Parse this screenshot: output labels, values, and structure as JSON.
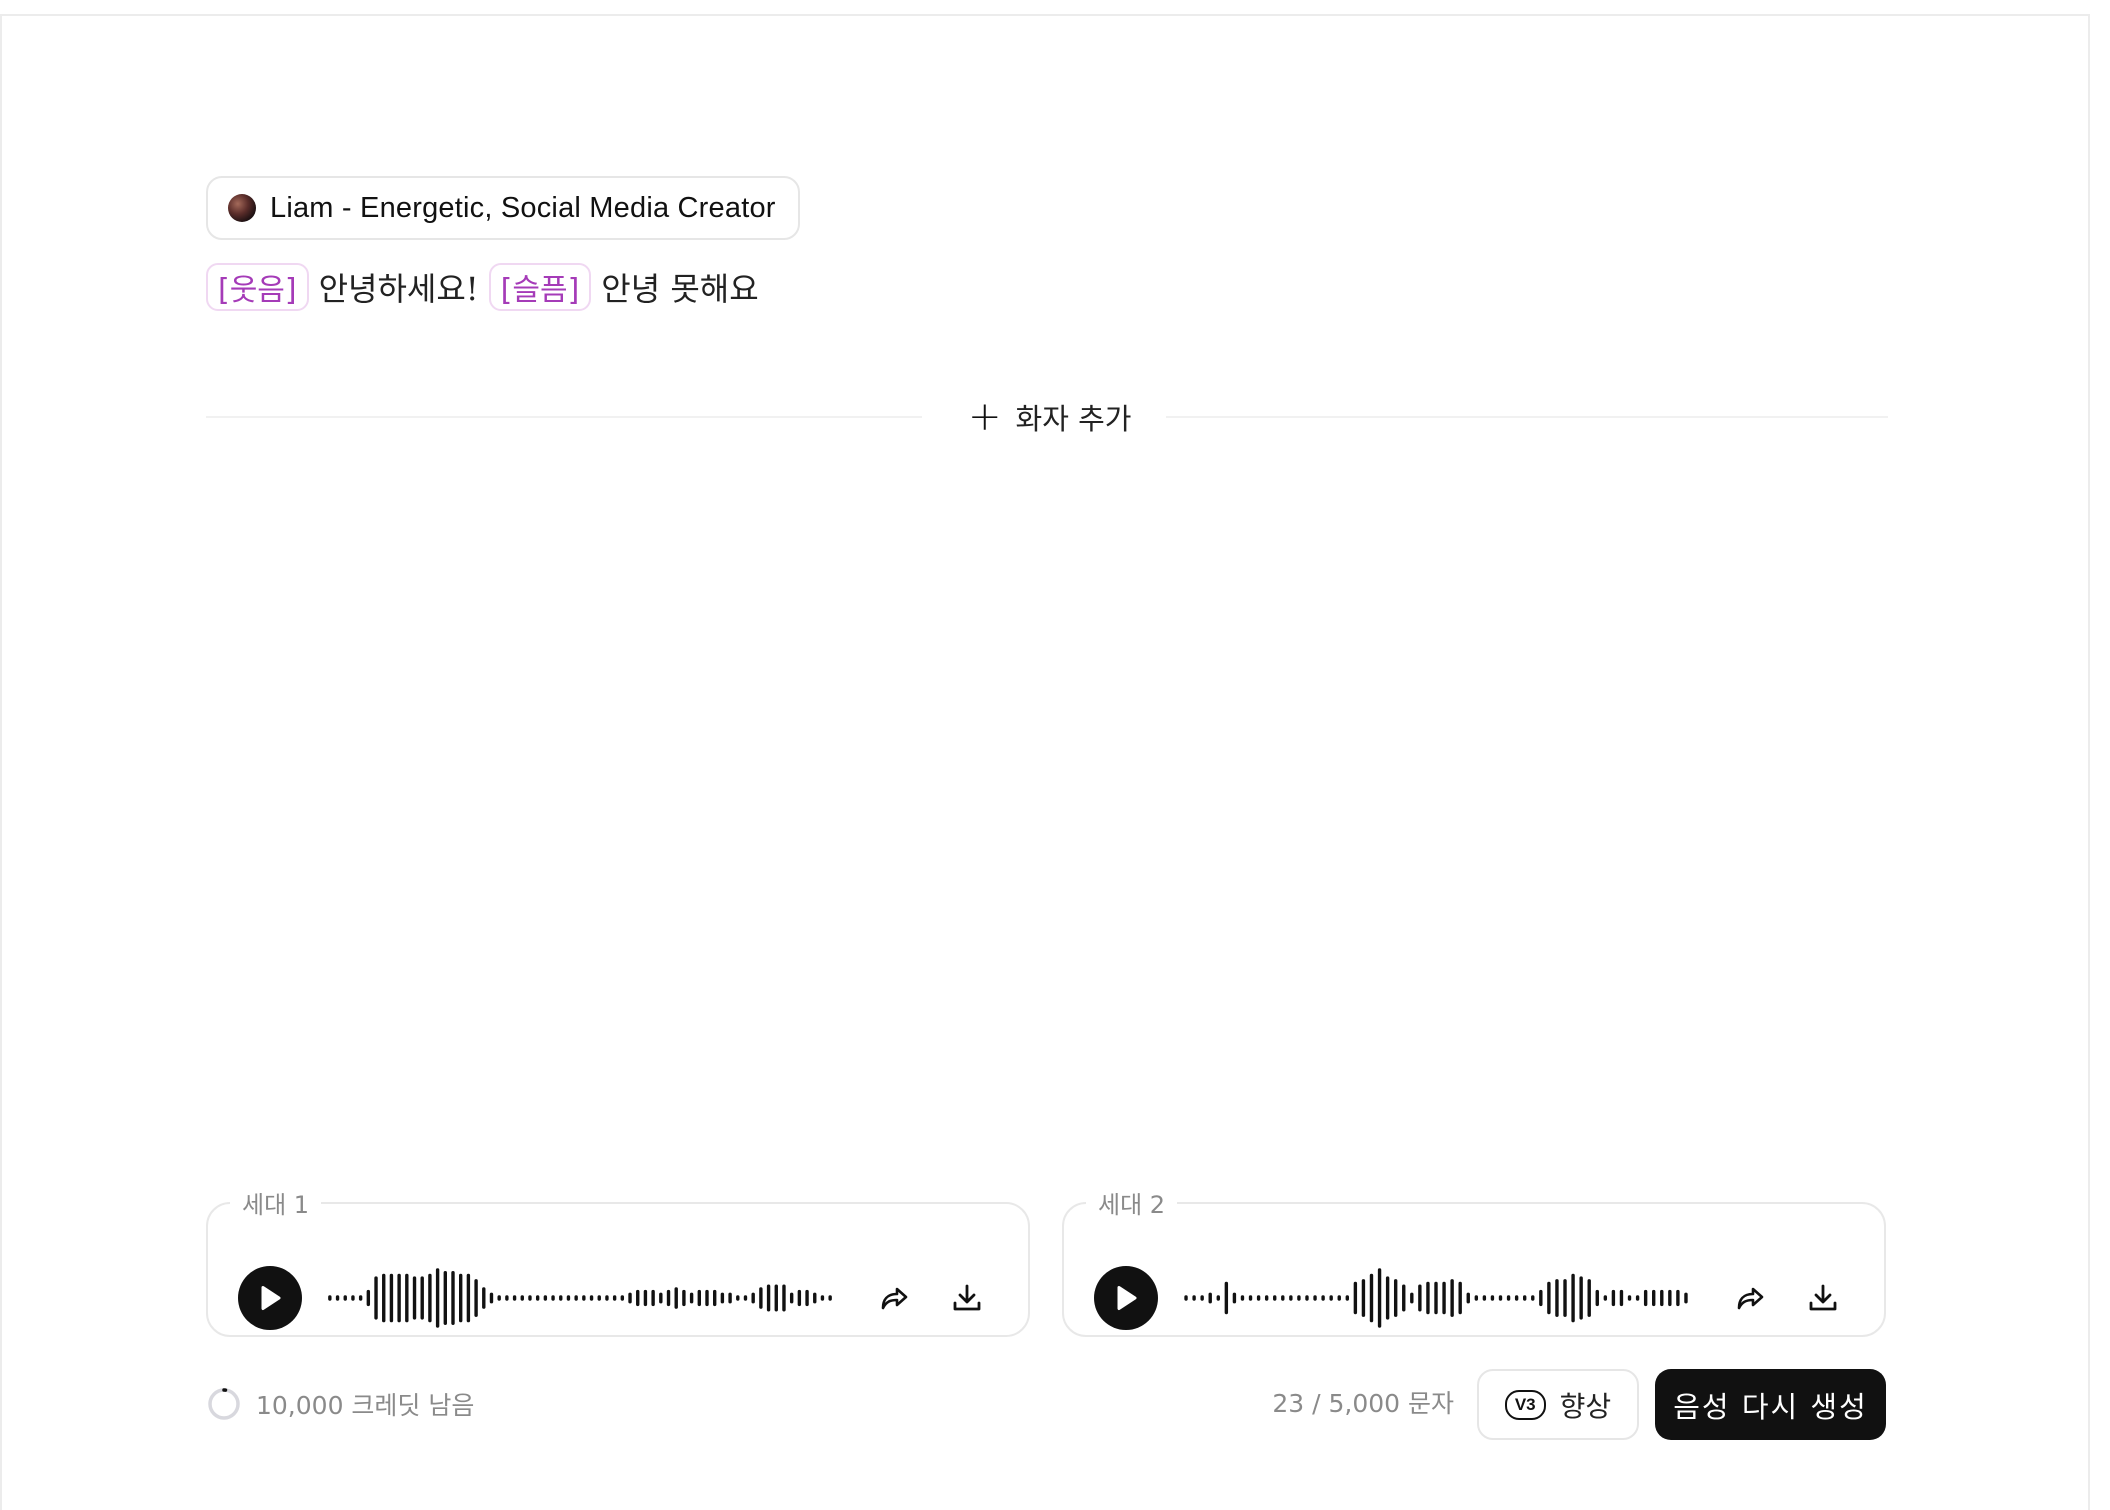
{
  "voice": {
    "name": "Liam - Energetic, Social Media Creator"
  },
  "script": {
    "tag_1": "[웃음]",
    "text_1": "안녕하세요!",
    "tag_2": "[슬픔]",
    "text_2": "안녕 못해요"
  },
  "add_speaker_label": "화자 추가",
  "generations": [
    {
      "label": "세대 1",
      "waveform": [
        1,
        1,
        1,
        1,
        1,
        3,
        8,
        9,
        9,
        9,
        9,
        8,
        8,
        9,
        11,
        10,
        10,
        9,
        9,
        7,
        4,
        2,
        1,
        1,
        1,
        1,
        1,
        1,
        1,
        1,
        1,
        1,
        1,
        1,
        1,
        1,
        1,
        1,
        1,
        2,
        3,
        3,
        3,
        2,
        3,
        4,
        3,
        2,
        3,
        3,
        3,
        2,
        2,
        1,
        1,
        2,
        4,
        5,
        5,
        5,
        2,
        3,
        3,
        2,
        1,
        1
      ]
    },
    {
      "label": "세대 2",
      "waveform": [
        1,
        1,
        1,
        2,
        1,
        6,
        2,
        1,
        1,
        1,
        1,
        1,
        1,
        1,
        1,
        1,
        1,
        1,
        1,
        1,
        1,
        6,
        7,
        9,
        11,
        8,
        7,
        5,
        2,
        5,
        6,
        6,
        6,
        7,
        6,
        2,
        1,
        1,
        1,
        1,
        1,
        1,
        1,
        1,
        3,
        6,
        7,
        7,
        9,
        8,
        7,
        3,
        1,
        3,
        3,
        1,
        1,
        3,
        3,
        3,
        3,
        3,
        2
      ]
    }
  ],
  "footer": {
    "credits": "10,000 크레딧 남음",
    "char_count": "23 / 5,000 문자",
    "model_badge": "V3",
    "enhance_label": "향상",
    "regenerate_label": "음성 다시 생성"
  },
  "icons": {
    "play": "play-icon",
    "share": "share-icon",
    "download": "download-icon",
    "plus": "plus-icon",
    "credits": "spinner-ring-icon"
  },
  "colors": {
    "tag_text": "#a53bb8",
    "tag_border": "#f0d8f2",
    "primary_button": "#111111",
    "muted_text": "#8a8a8a"
  }
}
